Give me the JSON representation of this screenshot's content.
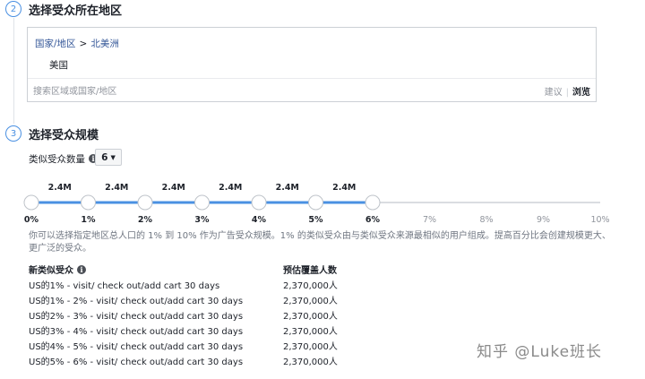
{
  "step2": {
    "number": "2",
    "title": "选择受众所在地区"
  },
  "location": {
    "breadcrumb_country": "国家/地区",
    "breadcrumb_sep": ">",
    "breadcrumb_region": "北美洲",
    "selected": "美国",
    "search_placeholder": "搜索区域或国家/地区",
    "suggest_label": "建议",
    "browse_label": "浏览"
  },
  "step3": {
    "number": "3",
    "title": "选择受众规模"
  },
  "audience_count": {
    "label": "类似受众数量",
    "value": "6",
    "info_icon": "info-icon"
  },
  "slider": {
    "ticks": [
      "0%",
      "1%",
      "2%",
      "3%",
      "4%",
      "5%",
      "6%",
      "7%",
      "8%",
      "9%",
      "10%"
    ],
    "segment_labels": [
      "2.4M",
      "2.4M",
      "2.4M",
      "2.4M",
      "2.4M",
      "2.4M"
    ],
    "selected_up_to_percent": 6,
    "active_color": "#4a90e2",
    "inactive_color": "#dadde1"
  },
  "description": "你可以选择指定地区总人口的 1% 到 10% 作为广告受众规模。1% 的类似受众由与类似受众来源最相似的用户组成。提高百分比会创建规模更大、更广泛的受众。",
  "table": {
    "header_audience": "新类似受众",
    "header_reach": "预估覆盖人数",
    "rows": [
      {
        "audience": "US的1% - visit/ check out/add cart 30 days",
        "reach": "2,370,000人"
      },
      {
        "audience": "US的1% - 2% - visit/ check out/add cart 30 days",
        "reach": "2,370,000人"
      },
      {
        "audience": "US的2% - 3% - visit/ check out/add cart 30 days",
        "reach": "2,370,000人"
      },
      {
        "audience": "US的3% - 4% - visit/ check out/add cart 30 days",
        "reach": "2,370,000人"
      },
      {
        "audience": "US的4% - 5% - visit/ check out/add cart 30 days",
        "reach": "2,370,000人"
      },
      {
        "audience": "US的5% - 6% - visit/ check out/add cart 30 days",
        "reach": "2,370,000人"
      }
    ]
  },
  "watermark": "知乎 @Luke班长"
}
